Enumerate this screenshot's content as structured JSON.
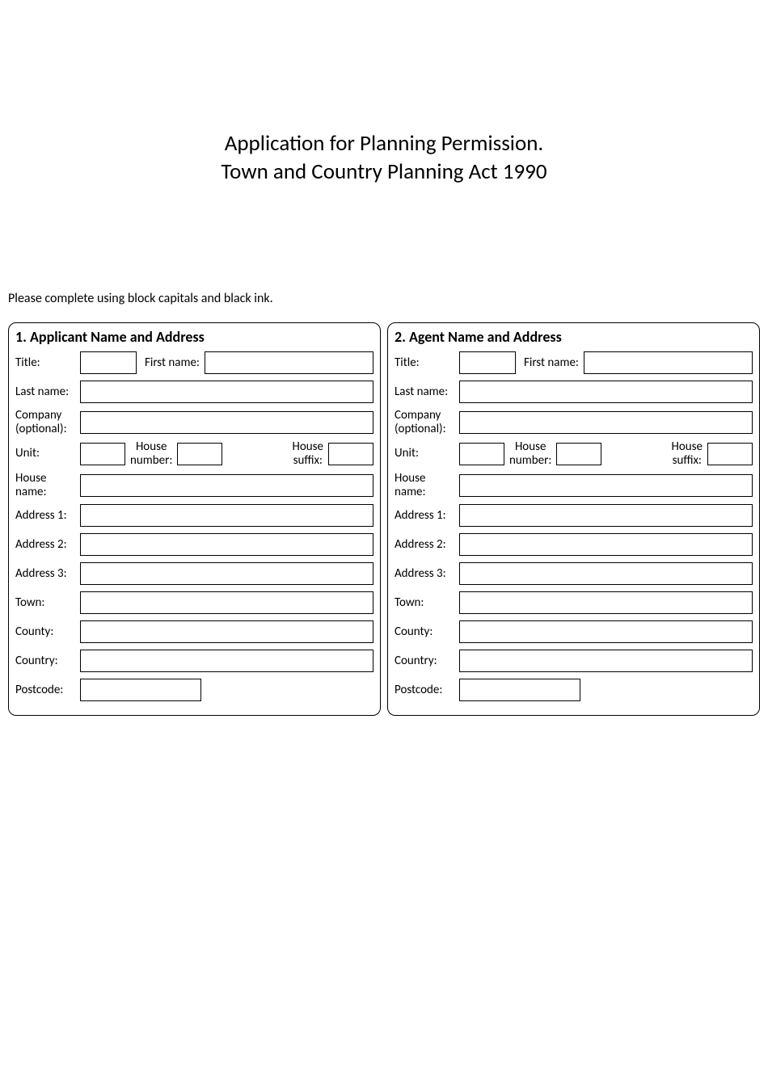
{
  "title": {
    "line1": "Application for Planning Permission.",
    "line2": "Town and Country Planning Act 1990"
  },
  "instruction": "Please complete using block capitals and black ink.",
  "sections": {
    "applicant": {
      "heading": "1.  Applicant Name and Address",
      "labels": {
        "title": "Title:",
        "first_name": "First name:",
        "last_name": "Last name:",
        "company": "Company\n(optional):",
        "unit": "Unit:",
        "house_number": "House\nnumber:",
        "house_suffix": "House\nsuffix:",
        "house_name": "House\nname:",
        "address1": "Address 1:",
        "address2": "Address 2:",
        "address3": "Address 3:",
        "town": "Town:",
        "county": "County:",
        "country": "Country:",
        "postcode": "Postcode:"
      }
    },
    "agent": {
      "heading": "2. Agent Name and Address",
      "labels": {
        "title": "Title:",
        "first_name": "First name:",
        "last_name": "Last name:",
        "company": "Company\n(optional):",
        "unit": "Unit:",
        "house_number": "House\nnumber:",
        "house_suffix": "House\nsuffix:",
        "house_name": "House\nname:",
        "address1": "Address 1:",
        "address2": "Address 2:",
        "address3": "Address 3:",
        "town": "Town:",
        "county": "County:",
        "country": "Country:",
        "postcode": "Postcode:"
      }
    }
  }
}
